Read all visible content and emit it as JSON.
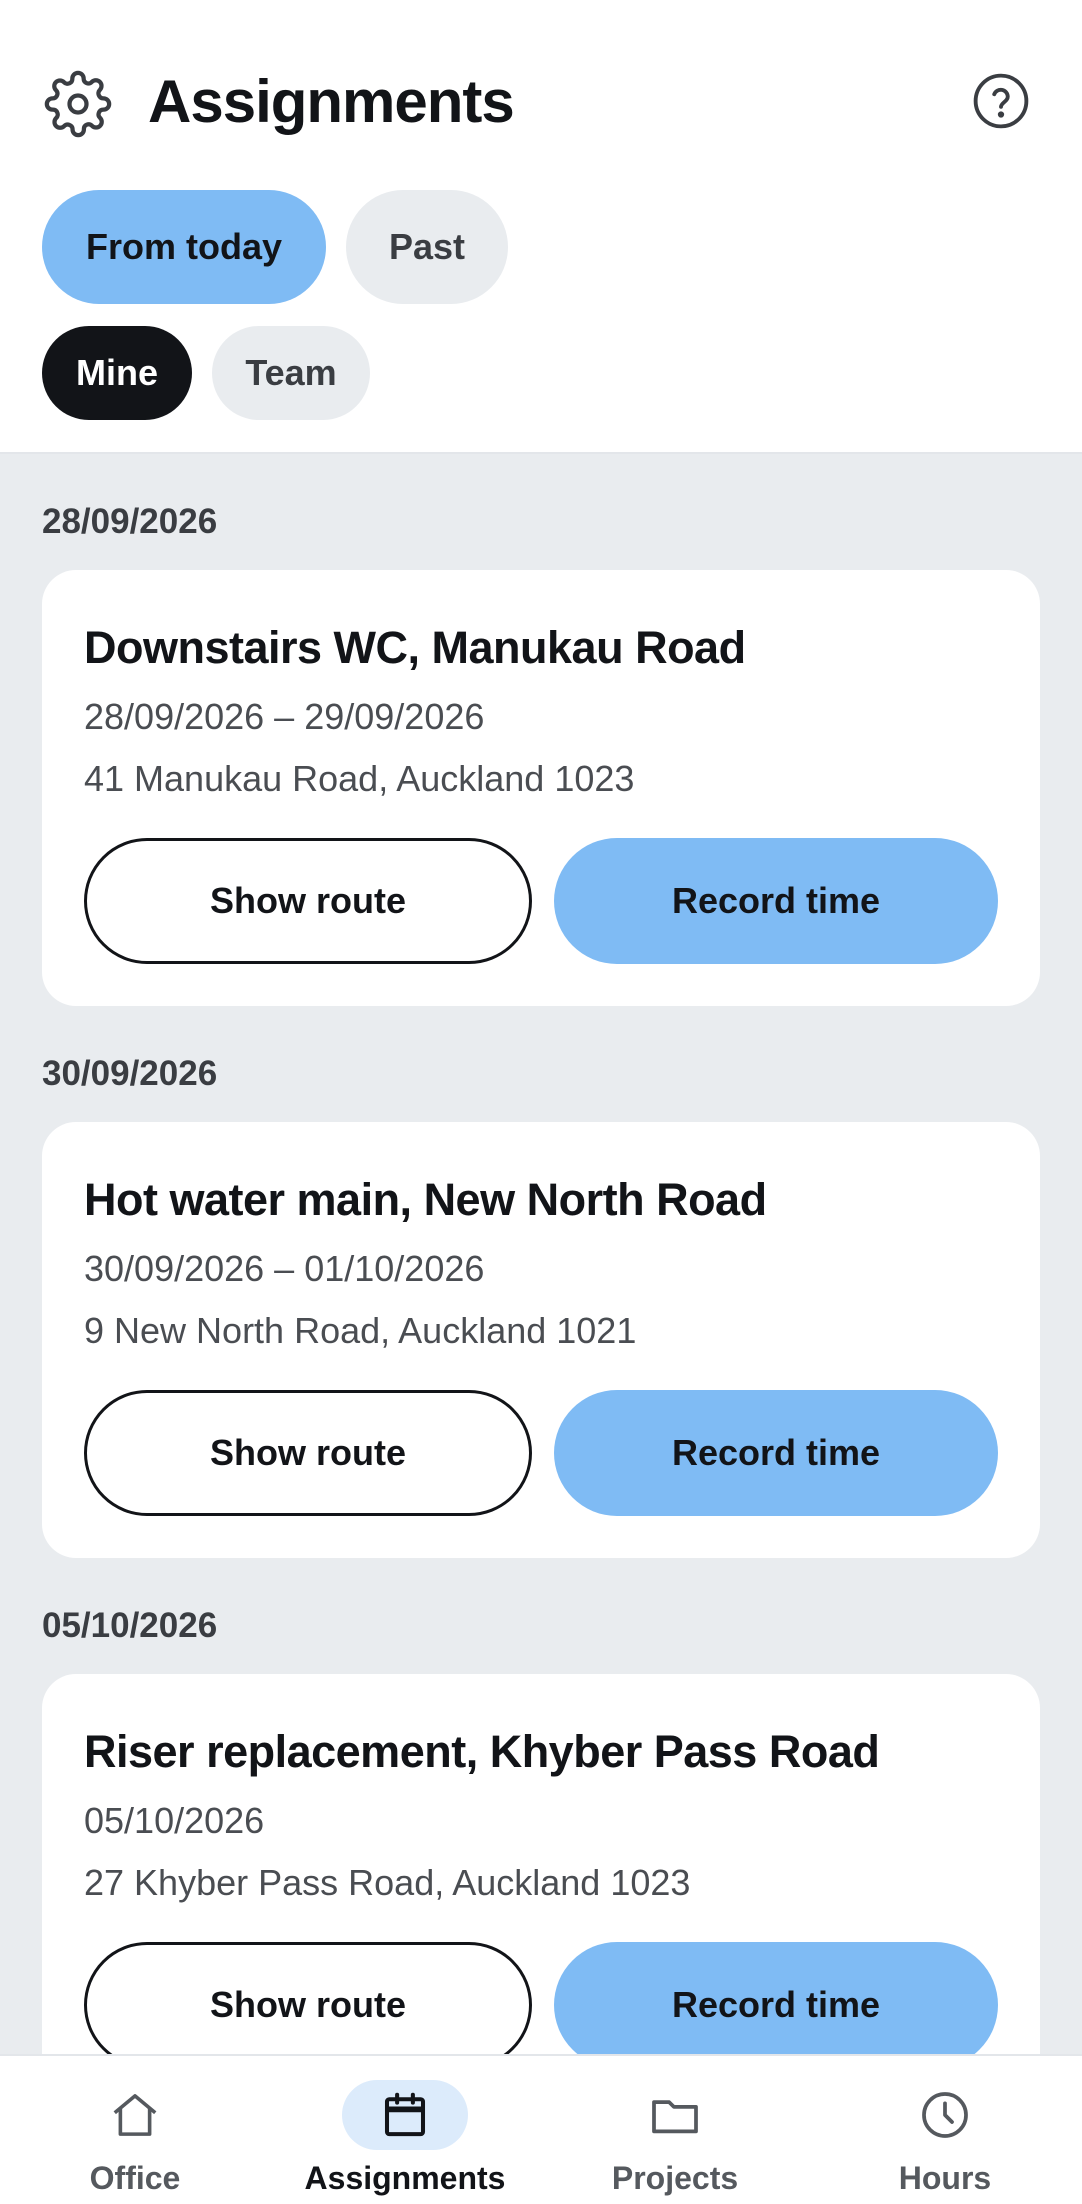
{
  "header": {
    "title": "Assignments",
    "settings_icon": "gear-icon",
    "help_icon": "question-circle-icon"
  },
  "filters": {
    "time": [
      {
        "label": "From today",
        "selected": true
      },
      {
        "label": "Past",
        "selected": false
      }
    ],
    "scope": [
      {
        "label": "Mine",
        "selected": true
      },
      {
        "label": "Team",
        "selected": false
      }
    ]
  },
  "groups": [
    {
      "date": "28/09/2026",
      "assignment": {
        "title": "Downstairs WC, Manukau Road",
        "dates": "28/09/2026 – 29/09/2026",
        "address": "41 Manukau Road, Auckland 1023",
        "route_label": "Show route",
        "record_label": "Record time"
      }
    },
    {
      "date": "30/09/2026",
      "assignment": {
        "title": "Hot water main, New North Road",
        "dates": "30/09/2026 – 01/10/2026",
        "address": "9 New North Road, Auckland 1021",
        "route_label": "Show route",
        "record_label": "Record time"
      }
    },
    {
      "date": "05/10/2026",
      "assignment": {
        "title": "Riser replacement, Khyber Pass Road",
        "dates": "05/10/2026",
        "address": "27 Khyber Pass Road, Auckland 1023",
        "route_label": "Show route",
        "record_label": "Record time"
      }
    }
  ],
  "nav": [
    {
      "label": "Office",
      "icon": "home-icon",
      "active": false
    },
    {
      "label": "Assignments",
      "icon": "calendar-icon",
      "active": true
    },
    {
      "label": "Projects",
      "icon": "folder-icon",
      "active": false
    },
    {
      "label": "Hours",
      "icon": "clock-icon",
      "active": false
    }
  ],
  "colors": {
    "accent": "#7fbbf4",
    "dark": "#121418",
    "background": "#e9ecef",
    "active_nav_bg": "#dcebfb"
  }
}
